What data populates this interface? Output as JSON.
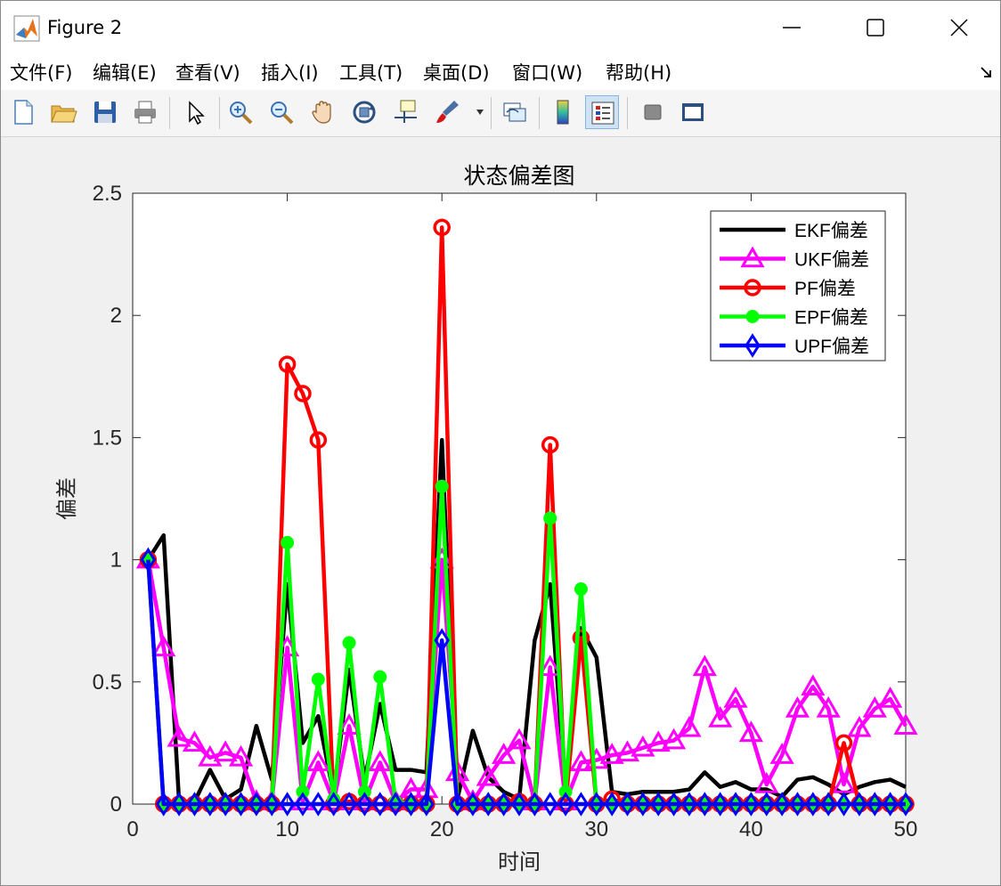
{
  "window": {
    "title": "Figure 2"
  },
  "menu": [
    "文件(F)",
    "编辑(E)",
    "查看(V)",
    "插入(I)",
    "工具(T)",
    "桌面(D)",
    "窗口(W)",
    "帮助(H)"
  ],
  "toolbar": [
    "new-file-icon",
    "open-folder-icon",
    "save-icon",
    "print-icon",
    "pointer-icon",
    "zoom-in-icon",
    "zoom-out-icon",
    "pan-hand-icon",
    "rotate-3d-icon",
    "data-cursor-icon",
    "brush-icon",
    "link-plot-icon",
    "colorbar-icon",
    "legend-icon",
    "hide-plot-tools-icon",
    "show-plot-tools-icon"
  ],
  "chart_data": {
    "type": "line",
    "title": "状态偏差图",
    "xlabel": "时间",
    "ylabel": "偏差",
    "xlim": [
      0,
      50
    ],
    "ylim": [
      0,
      2.5
    ],
    "xticks": [
      0,
      10,
      20,
      30,
      40,
      50
    ],
    "yticks": [
      0,
      0.5,
      1,
      1.5,
      2,
      2.5
    ],
    "ytick_labels": [
      "0",
      "0.5",
      "1",
      "1.5",
      "2",
      "2.5"
    ],
    "grid": false,
    "legend_position": "top-right",
    "x": [
      1,
      2,
      3,
      4,
      5,
      6,
      7,
      8,
      9,
      10,
      11,
      12,
      13,
      14,
      15,
      16,
      17,
      18,
      19,
      20,
      21,
      22,
      23,
      24,
      25,
      26,
      27,
      28,
      29,
      30,
      31,
      32,
      33,
      34,
      35,
      36,
      37,
      38,
      39,
      40,
      41,
      42,
      43,
      44,
      45,
      46,
      47,
      48,
      49,
      50
    ],
    "series": [
      {
        "name": "EKF偏差",
        "color": "#000000",
        "marker": "none",
        "values": [
          1.0,
          1.1,
          0.01,
          0.01,
          0.14,
          0.02,
          0.06,
          0.32,
          0.1,
          0.9,
          0.25,
          0.36,
          0.04,
          0.55,
          0.1,
          0.41,
          0.14,
          0.14,
          0.13,
          1.49,
          0.02,
          0.3,
          0.11,
          0.05,
          0.02,
          0.67,
          0.9,
          0.05,
          0.72,
          0.6,
          0.05,
          0.04,
          0.05,
          0.05,
          0.05,
          0.06,
          0.13,
          0.07,
          0.09,
          0.06,
          0.06,
          0.03,
          0.1,
          0.11,
          0.08,
          0.04,
          0.07,
          0.09,
          0.1,
          0.07
        ]
      },
      {
        "name": "UKF偏差",
        "color": "#ff00ff",
        "marker": "triangle",
        "values": [
          1.0,
          0.64,
          0.27,
          0.25,
          0.19,
          0.21,
          0.19,
          0.01,
          0.01,
          0.64,
          0.01,
          0.17,
          0.01,
          0.32,
          0.01,
          0.17,
          0.01,
          0.06,
          0.06,
          1.0,
          0.13,
          0.01,
          0.11,
          0.2,
          0.26,
          0.01,
          0.56,
          0.01,
          0.17,
          0.18,
          0.2,
          0.21,
          0.23,
          0.25,
          0.26,
          0.31,
          0.56,
          0.35,
          0.43,
          0.29,
          0.08,
          0.2,
          0.39,
          0.48,
          0.39,
          0.08,
          0.31,
          0.39,
          0.43,
          0.32
        ]
      },
      {
        "name": "PF偏差",
        "color": "#ff0000",
        "marker": "circle",
        "values": [
          1.0,
          0.0,
          0.0,
          0.0,
          0.0,
          0.0,
          0.0,
          0.0,
          0.0,
          1.8,
          1.68,
          1.49,
          0.0,
          0.01,
          0.0,
          0.0,
          0.0,
          0.0,
          0.0,
          2.36,
          0.0,
          0.0,
          0.0,
          0.0,
          0.01,
          0.0,
          1.47,
          0.0,
          0.68,
          0.0,
          0.02,
          0.0,
          0.0,
          0.0,
          0.0,
          0.0,
          0.0,
          0.0,
          0.0,
          0.0,
          0.0,
          0.0,
          0.0,
          0.0,
          0.0,
          0.25,
          0.0,
          0.0,
          0.0,
          0.0
        ]
      },
      {
        "name": "EPF偏差",
        "color": "#00ff00",
        "marker": "dot",
        "values": [
          1.0,
          0.0,
          0.0,
          0.0,
          0.0,
          0.0,
          0.0,
          0.0,
          0.0,
          1.07,
          0.05,
          0.51,
          0.02,
          0.66,
          0.05,
          0.52,
          0.01,
          0.0,
          0.0,
          1.3,
          0.0,
          0.0,
          0.0,
          0.0,
          0.0,
          0.0,
          1.17,
          0.05,
          0.88,
          0.0,
          0.0,
          0.0,
          0.0,
          0.0,
          0.0,
          0.0,
          0.0,
          0.0,
          0.0,
          0.0,
          0.0,
          0.0,
          0.0,
          0.0,
          0.0,
          0.0,
          0.0,
          0.0,
          0.0,
          0.0
        ]
      },
      {
        "name": "UPF偏差",
        "color": "#0000ff",
        "marker": "diamond",
        "values": [
          1.0,
          0.0,
          0.0,
          0.0,
          0.0,
          0.0,
          0.0,
          0.0,
          0.0,
          0.0,
          0.0,
          0.0,
          0.0,
          0.0,
          0.0,
          0.0,
          0.0,
          0.0,
          0.0,
          0.67,
          0.0,
          0.0,
          0.0,
          0.0,
          0.0,
          0.0,
          0.0,
          0.0,
          0.0,
          0.0,
          0.0,
          0.0,
          0.0,
          0.0,
          0.0,
          0.0,
          0.0,
          0.0,
          0.0,
          0.0,
          0.0,
          0.0,
          0.0,
          0.0,
          0.0,
          0.0,
          0.0,
          0.0,
          0.0,
          0.0
        ]
      }
    ]
  }
}
